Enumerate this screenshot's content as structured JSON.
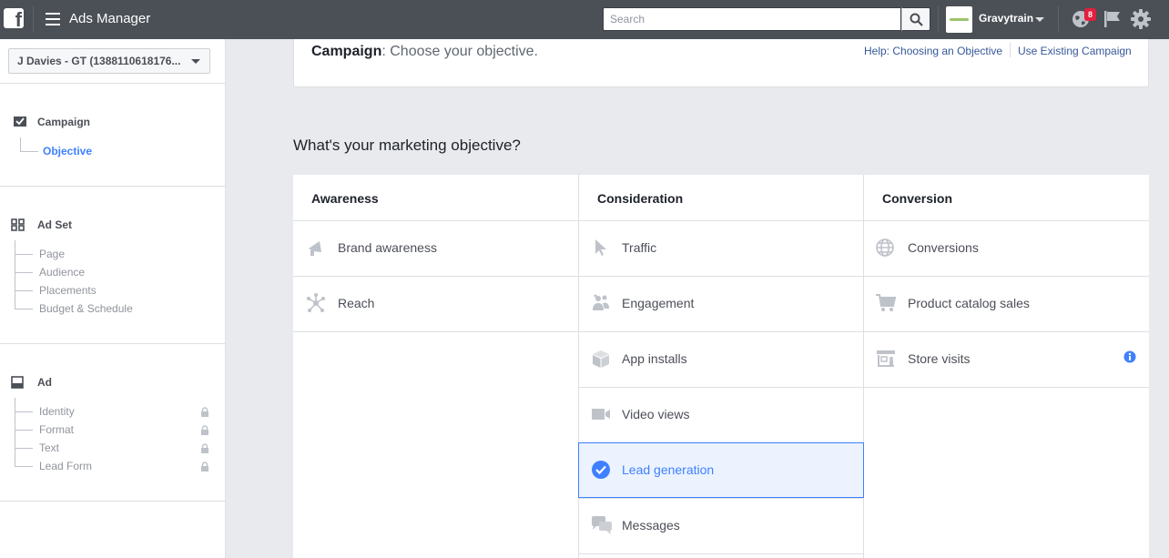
{
  "header": {
    "logo": "f",
    "app_title": "Ads Manager",
    "search": {
      "placeholder": "Search"
    },
    "account_name": "Gravytrain",
    "notification_count": "8"
  },
  "sidebar": {
    "account_selector": "J Davies - GT (1388110618176...",
    "sections": {
      "campaign": {
        "label": "Campaign",
        "items": [
          "Objective"
        ]
      },
      "adset": {
        "label": "Ad Set",
        "items": [
          "Page",
          "Audience",
          "Placements",
          "Budget & Schedule"
        ]
      },
      "ad": {
        "label": "Ad",
        "items": [
          "Identity",
          "Format",
          "Text",
          "Lead Form"
        ]
      }
    }
  },
  "main": {
    "campaign_card": {
      "title_bold": "Campaign",
      "title_rest": ": Choose your objective.",
      "help_link": "Help: Choosing an Objective",
      "use_existing_link": "Use Existing Campaign"
    },
    "question": "What's your marketing objective?",
    "columns": [
      {
        "heading": "Awareness",
        "objectives": [
          "Brand awareness",
          "Reach"
        ]
      },
      {
        "heading": "Consideration",
        "objectives": [
          "Traffic",
          "Engagement",
          "App installs",
          "Video views",
          "Lead generation",
          "Messages"
        ]
      },
      {
        "heading": "Conversion",
        "objectives": [
          "Conversions",
          "Product catalog sales",
          "Store visits"
        ]
      }
    ],
    "selected_objective": "Lead generation"
  },
  "colors": {
    "topbar": "#4b4f56",
    "accent": "#4080ff",
    "link": "#365899"
  }
}
